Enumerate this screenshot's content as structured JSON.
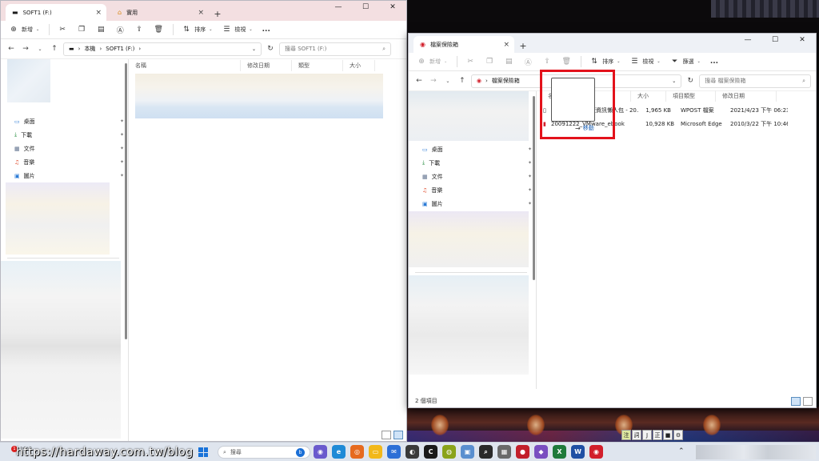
{
  "left_window": {
    "tab_active": "SOFT1 (F:)",
    "tab_inactive": "實用",
    "toolbar": {
      "new_label": "新增",
      "sort_label": "排序",
      "view_label": "檢視",
      "more_label": "..."
    },
    "breadcrumb": {
      "root": "本機",
      "current": "SOFT1 (F:)"
    },
    "search_placeholder": "搜尋 SOFT1 (F:)",
    "columns": {
      "name": "名稱",
      "modified": "修改日期",
      "type": "類型",
      "size": "大小"
    },
    "quick_access": [
      {
        "label": "桌面",
        "icon": "desktop-icon",
        "color": "#2b7bd6"
      },
      {
        "label": "下載",
        "icon": "download-icon",
        "color": "#1f8a3a"
      },
      {
        "label": "文件",
        "icon": "document-icon",
        "color": "#5a6d8a"
      },
      {
        "label": "音樂",
        "icon": "music-icon",
        "color": "#e04b2b"
      },
      {
        "label": "圖片",
        "icon": "picture-icon",
        "color": "#2b7bd6"
      }
    ]
  },
  "right_window": {
    "tab_title": "檔案保險箱",
    "toolbar": {
      "new_label": "新增",
      "sort_label": "排序",
      "view_label": "檢視",
      "filter_label": "篩選",
      "more_label": "..."
    },
    "breadcrumb": {
      "current": "檔案保險箱"
    },
    "search_placeholder": "搜尋 檔案保險箱",
    "columns": {
      "name": "名稱",
      "size": "大小",
      "type": "項目類型",
      "modified": "修改日期"
    },
    "files": [
      {
        "name": "【實用資訊】健康資訊懶人包 - 20...",
        "size": "1,965 KB",
        "type": "WPOST 檔案",
        "modified": "2021/4/23 下午 06:23",
        "icon": "text-file-icon"
      },
      {
        "name": "20091222_VMware_ebook",
        "size": "10,928 KB",
        "type": "Microsoft Edge P...",
        "modified": "2010/3/22 下午 10:46",
        "icon": "pdf-file-icon"
      }
    ],
    "quick_access": [
      {
        "label": "桌面",
        "icon": "desktop-icon",
        "color": "#2b7bd6"
      },
      {
        "label": "下載",
        "icon": "download-icon",
        "color": "#1f8a3a"
      },
      {
        "label": "文件",
        "icon": "document-icon",
        "color": "#5a6d8a"
      },
      {
        "label": "音樂",
        "icon": "music-icon",
        "color": "#e04b2b"
      },
      {
        "label": "圖片",
        "icon": "picture-icon",
        "color": "#2b7bd6"
      }
    ],
    "drop_hint": "移動",
    "status_text": "2 個項目"
  },
  "taskbar": {
    "weather_temp": "29°C",
    "weather_badge": "1",
    "search_placeholder": "搜尋",
    "ime_keys": [
      "注",
      "詞",
      "J",
      "正",
      "■"
    ]
  },
  "watermark_text": "https://hardaway.com.tw/blog",
  "colors": {
    "highlight": "#e3121b",
    "accent": "#1a73d9"
  }
}
